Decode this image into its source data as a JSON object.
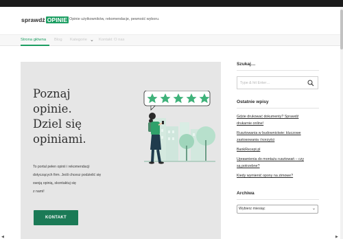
{
  "header": {
    "logo_part1": "sprawdź",
    "logo_part2": "OPINIE",
    "tagline": "Opinie użytkowników, rekomendacje, pewność wyboru."
  },
  "nav": {
    "items": [
      {
        "label": "Strona główna",
        "active": true
      },
      {
        "label": "Blog"
      },
      {
        "label": "Kategorie"
      },
      {
        "label": "Kontakt"
      },
      {
        "label": "O nas"
      }
    ],
    "dropdown_icon": "chevron-down-icon"
  },
  "hero": {
    "title_lines": [
      "Poznaj",
      "opinie.",
      "Dziel się",
      "opiniami."
    ],
    "desc_lines": [
      "To portal pełen opinii i rekomendacji",
      "dotyczących firm. Jeśli chcesz podzielić się",
      "swoją opinią, skontaktuj się",
      "z nami!"
    ],
    "button_label": "KONTAKT",
    "stars": 5
  },
  "sidebar": {
    "search_title": "Szukaj…",
    "search_placeholder": "Type & hit Enter…",
    "recent_title": "Ostatnie wpisy",
    "recent_posts": [
      [
        "Gdzie drukować dokumenty? Sprawdź",
        "drukarnie online!"
      ],
      [
        "Rusztowania w budownictwie: kluczowe",
        "zastosowania i korzyści"
      ],
      [
        "BankRecept.pl"
      ],
      [
        "Uprawnienia do montażu rusztowań – czy",
        "są potrzebne?"
      ],
      [
        "Kiedy wymienić opony na zimowe?"
      ]
    ],
    "archive_title": "Archiwa",
    "archive_selected": "Wybierz miesiąc"
  },
  "colors": {
    "accent": "#1c9e62",
    "button": "#1b7a56",
    "hero_bg": "#e6e6e6"
  }
}
